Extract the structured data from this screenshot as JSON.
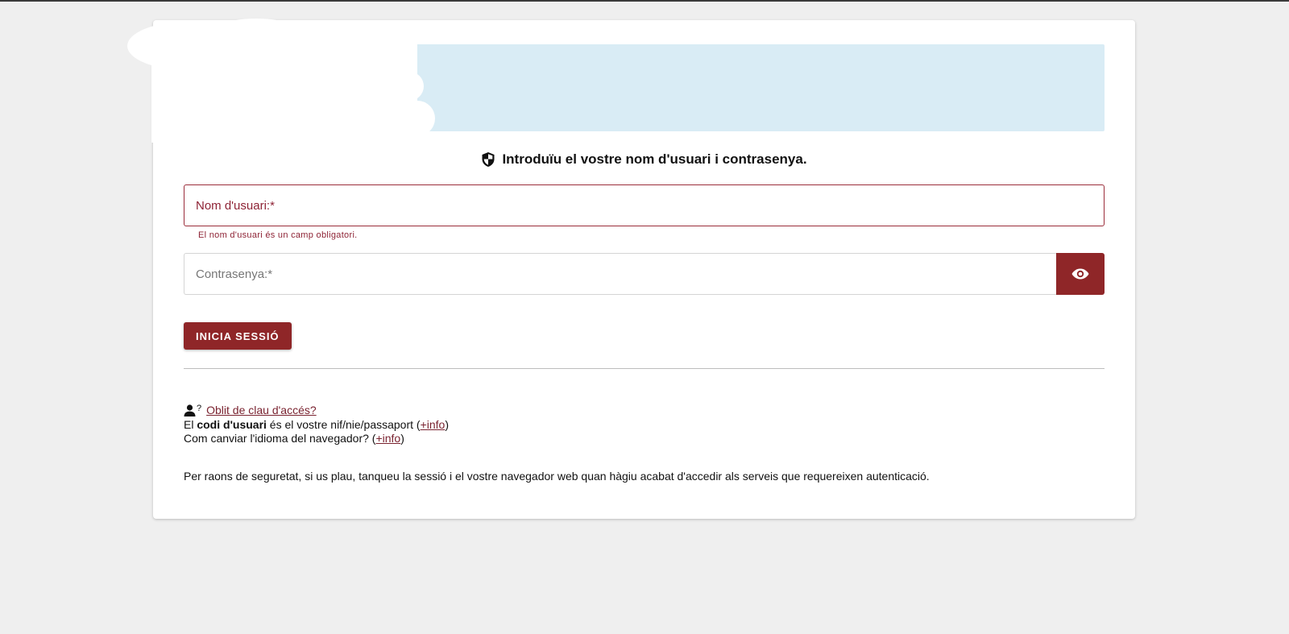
{
  "form": {
    "heading": "Introduïu el vostre nom d'usuari i contrasenya.",
    "username_placeholder": "Nom d'usuari:*",
    "username_error": "El nom d'usuari és un camp obligatori.",
    "password_placeholder": "Contrasenya:*",
    "login_label": "INICIA SESSIÓ"
  },
  "info": {
    "forgot_link": "Oblit de clau d'accés?",
    "user_code_prefix": "El ",
    "user_code_bold": "codi d'usuari",
    "user_code_suffix": " és el vostre nif/nie/passaport (",
    "info_link_1": "+info",
    "close_paren": ")",
    "language_prefix": "Com canviar l'idioma del navegador? (",
    "info_link_2": "+info",
    "security_notice": "Per raons de seguretat, si us plau, tanqueu la sessió i el vostre navegador web quan hàgiu acabat d'accedir als serveis que requereixen autenticació."
  },
  "icons": {
    "heading": "shield-icon",
    "password_toggle": "eye-icon",
    "forgot": "user-question-icon"
  },
  "colors": {
    "accent": "#8f2628",
    "error": "#8e2335",
    "banner": "#d9ecf5",
    "link": "#7a2330"
  }
}
